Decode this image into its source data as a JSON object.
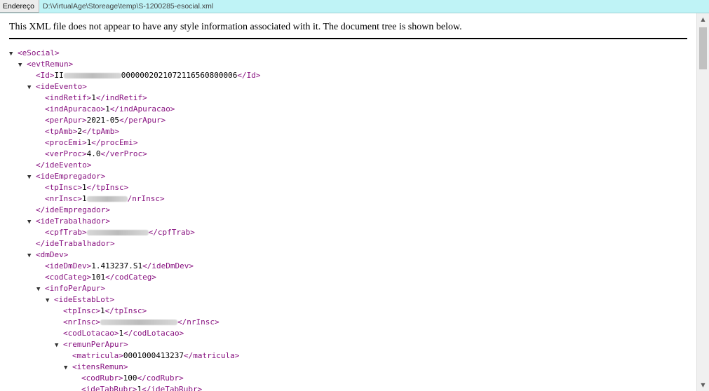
{
  "address_bar": {
    "label": "Endereço",
    "path": "D:\\VirtualAge\\Storeage\\temp\\S-1200285-esocial.xml"
  },
  "notice": "This XML file does not appear to have any style information associated with it. The document tree is shown below.",
  "icons": {
    "collapse": "triangle-down-icon",
    "scroll_up": "arrow-up-icon",
    "scroll_down": "arrow-down-icon"
  },
  "colors": {
    "tag": "#881280",
    "address_bar_bg": "#bff3f6"
  },
  "tree": [
    {
      "indent": 0,
      "arrow": true,
      "open": "<eSocial>"
    },
    {
      "indent": 1,
      "arrow": true,
      "open": "<evtRemun>"
    },
    {
      "indent": 2,
      "arrow": false,
      "open": "<Id>",
      "text": "II",
      "redacted": 82,
      "text2": "000000202107211656080000 6",
      "close": "</Id>"
    },
    {
      "indent": 2,
      "arrow": true,
      "open": "<ideEvento>"
    },
    {
      "indent": 3,
      "arrow": false,
      "open": "<indRetif>",
      "text": "1",
      "close": "</indRetif>"
    },
    {
      "indent": 3,
      "arrow": false,
      "open": "<indApuracao>",
      "text": "1",
      "close": "</indApuracao>"
    },
    {
      "indent": 3,
      "arrow": false,
      "open": "<perApur>",
      "text": "2021-05",
      "close": "</perApur>"
    },
    {
      "indent": 3,
      "arrow": false,
      "open": "<tpAmb>",
      "text": "2",
      "close": "</tpAmb>"
    },
    {
      "indent": 3,
      "arrow": false,
      "open": "<procEmi>",
      "text": "1",
      "close": "</procEmi>"
    },
    {
      "indent": 3,
      "arrow": false,
      "open": "<verProc>",
      "text": "4.0",
      "close": "</verProc>"
    },
    {
      "indent": 2,
      "arrow": false,
      "open": "</ideEvento>"
    },
    {
      "indent": 2,
      "arrow": true,
      "open": "<ideEmpregador>"
    },
    {
      "indent": 3,
      "arrow": false,
      "open": "<tpInsc>",
      "text": "1",
      "close": "</tpInsc>"
    },
    {
      "indent": 3,
      "arrow": false,
      "open": "<nrInsc>",
      "text": "1",
      "redacted": 58,
      "close": "/nrInsc>"
    },
    {
      "indent": 2,
      "arrow": false,
      "open": "</ideEmpregador>"
    },
    {
      "indent": 2,
      "arrow": true,
      "open": "<ideTrabalhador>"
    },
    {
      "indent": 3,
      "arrow": false,
      "open": "<cpfTrab>",
      "text": "",
      "redacted": 88,
      "close": "</cpfTrab>"
    },
    {
      "indent": 2,
      "arrow": false,
      "open": "</ideTrabalhador>"
    },
    {
      "indent": 2,
      "arrow": true,
      "open": "<dmDev>"
    },
    {
      "indent": 3,
      "arrow": false,
      "open": "<ideDmDev>",
      "text": "1.413237.S1",
      "close": "</ideDmDev>"
    },
    {
      "indent": 3,
      "arrow": false,
      "open": "<codCateg>",
      "text": "101",
      "close": "</codCateg>"
    },
    {
      "indent": 3,
      "arrow": true,
      "open": "<infoPerApur>"
    },
    {
      "indent": 4,
      "arrow": true,
      "open": "<ideEstabLot>"
    },
    {
      "indent": 5,
      "arrow": false,
      "open": "<tpInsc>",
      "text": "1",
      "close": "</tpInsc>"
    },
    {
      "indent": 5,
      "arrow": false,
      "open": "<nrInsc>",
      "text": "",
      "redacted": 110,
      "close": "</nrInsc>"
    },
    {
      "indent": 5,
      "arrow": false,
      "open": "<codLotacao>",
      "text": "1",
      "close": "</codLotacao>"
    },
    {
      "indent": 5,
      "arrow": true,
      "open": "<remunPerApur>"
    },
    {
      "indent": 6,
      "arrow": false,
      "open": "<matricula>",
      "text": "0001000413237",
      "close": "</matricula>"
    },
    {
      "indent": 6,
      "arrow": true,
      "open": "<itensRemun>"
    },
    {
      "indent": 7,
      "arrow": false,
      "open": "<codRubr>",
      "text": "100",
      "close": "</codRubr>"
    },
    {
      "indent": 7,
      "arrow": false,
      "open": "<ideTabRubr>",
      "text": "1",
      "close": "</ideTabRubr>"
    }
  ]
}
